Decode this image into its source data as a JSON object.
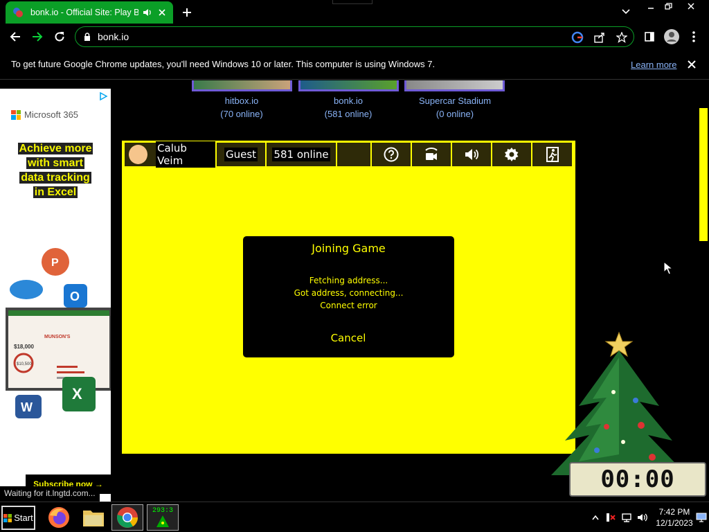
{
  "browser": {
    "tab_title": "bonk.io - Official Site: Play Bo",
    "url": "bonk.io",
    "infobar_message": "To get future Google Chrome updates, you'll need Windows 10 or later. This computer is using Windows 7.",
    "infobar_link": "Learn more",
    "status_text": "Waiting for it.lngtd.com..."
  },
  "ad": {
    "brand": "Microsoft 365",
    "headline_lines": [
      "Achieve more",
      "with smart",
      "data tracking",
      "in Excel"
    ],
    "cta": "Subscribe now →",
    "spreadsheet_title": "MUNSON'S",
    "spreadsheet_amount_1": "$18,000",
    "spreadsheet_amount_2": "$10,500"
  },
  "games": [
    {
      "name": "hitbox.io",
      "online": "(70 online)"
    },
    {
      "name": "bonk.io",
      "online": "(581 online)"
    },
    {
      "name": "Supercar Stadium",
      "online": "(0 online)"
    }
  ],
  "game": {
    "player_name": "Calub Veim",
    "account_type": "Guest",
    "online_count": "581 online",
    "icons": [
      "help-icon",
      "camera-icon",
      "sound-icon",
      "settings-icon",
      "exit-icon"
    ]
  },
  "dialog": {
    "title": "Joining Game",
    "lines": [
      "Fetching address...",
      "Got address, connecting...",
      "Connect error"
    ],
    "cancel": "Cancel"
  },
  "overlay": {
    "clock_digits": "00:00"
  },
  "taskbar": {
    "start_label": "Start",
    "app_counter": "293:3",
    "time": "7:42 PM",
    "date": "12/1/2023"
  },
  "colors": {
    "accent_green": "#0b9f27",
    "game_yellow": "#ffff00",
    "link_blue": "#8ab4f8"
  }
}
